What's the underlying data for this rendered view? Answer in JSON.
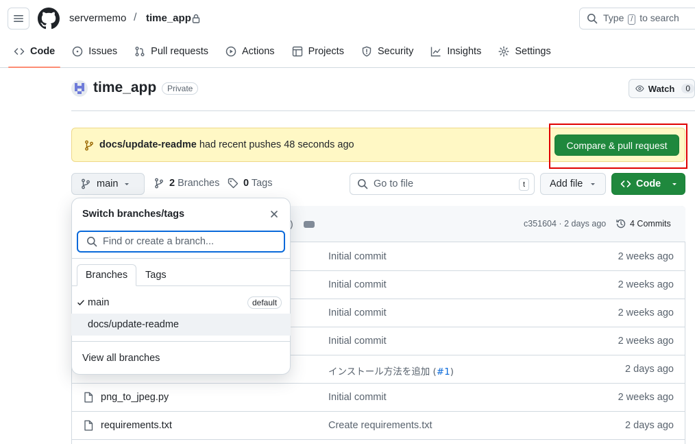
{
  "header": {
    "owner": "servermemo",
    "separator": "/",
    "repo": "time_app",
    "search_prefix": "Type",
    "search_key": "/",
    "search_suffix": "to search"
  },
  "nav": [
    {
      "label": "Code",
      "icon": "code-icon",
      "active": true
    },
    {
      "label": "Issues",
      "icon": "issue-icon"
    },
    {
      "label": "Pull requests",
      "icon": "pull-request-icon"
    },
    {
      "label": "Actions",
      "icon": "play-icon"
    },
    {
      "label": "Projects",
      "icon": "table-icon"
    },
    {
      "label": "Security",
      "icon": "shield-icon"
    },
    {
      "label": "Insights",
      "icon": "graph-icon"
    },
    {
      "label": "Settings",
      "icon": "gear-icon"
    }
  ],
  "repo": {
    "title": "time_app",
    "visibility": "Private",
    "watch_label": "Watch",
    "watch_count": "0"
  },
  "banner": {
    "branch": "docs/update-readme",
    "message": "had recent pushes 48 seconds ago",
    "button": "Compare & pull request"
  },
  "toolbar": {
    "branch": "main",
    "branches_count": "2",
    "branches_label": "Branches",
    "tags_count": "0",
    "tags_label": "Tags",
    "goto_placeholder": "Go to file",
    "goto_key": "t",
    "add_file": "Add file",
    "code": "Code"
  },
  "table": {
    "paren": ")",
    "last_commit": "c351604 · 2 days ago",
    "commits_label": "4 Commits",
    "rows": [
      {
        "name": "",
        "message": "Initial commit",
        "time": "2 weeks ago"
      },
      {
        "name": "",
        "message": "Initial commit",
        "time": "2 weeks ago"
      },
      {
        "name": "",
        "message": "Initial commit",
        "time": "2 weeks ago"
      },
      {
        "name": "",
        "message": "Initial commit",
        "time": "2 weeks ago"
      },
      {
        "name": "",
        "message": "インストール方法を追加 (",
        "pr": "#1",
        "message_end": ")",
        "time": "2 days ago"
      },
      {
        "name": "png_to_jpeg.py",
        "message": "Initial commit",
        "time": "2 weeks ago"
      },
      {
        "name": "requirements.txt",
        "message": "Create requirements.txt",
        "time": "2 days ago"
      }
    ]
  },
  "dropdown": {
    "title": "Switch branches/tags",
    "input_placeholder": "Find or create a branch...",
    "tab_branches": "Branches",
    "tab_tags": "Tags",
    "branch_main": "main",
    "default_badge": "default",
    "branch_docs": "docs/update-readme",
    "view_all": "View all branches"
  },
  "colors": {
    "accent_green": "#1f883d",
    "banner_bg": "#fff8c5",
    "highlight_red": "#e00000",
    "focus_blue": "#0969da"
  }
}
